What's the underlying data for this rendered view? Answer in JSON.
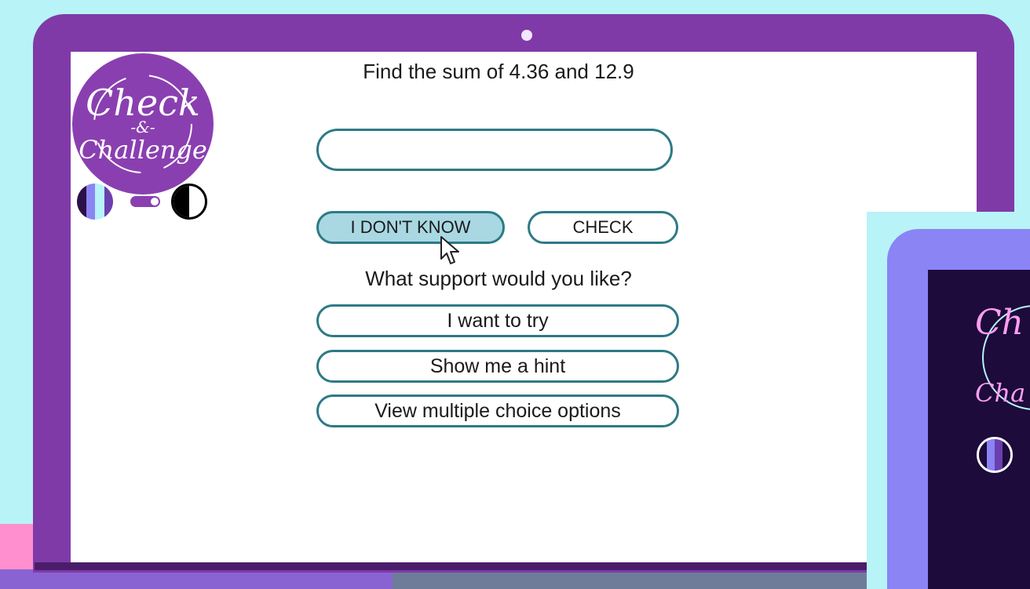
{
  "logo": {
    "line1": "Check",
    "line2": "-&-",
    "line3": "Challenge"
  },
  "question": {
    "text": "Find the sum of 4.36 and 12.9",
    "answer_value": "",
    "answer_placeholder": ""
  },
  "actions": {
    "dont_know_label": "I DON'T KNOW",
    "check_label": "CHECK"
  },
  "support": {
    "heading": "What support would you like?",
    "options": [
      "I want to try",
      "Show me a hint",
      "View multiple choice options"
    ]
  },
  "preview": {
    "logo_line1": "Ch",
    "logo_line3": "Cha"
  },
  "colors": {
    "frame": "#7f3aa8",
    "accent": "#2d7a86",
    "button_active": "#a9d8e3",
    "background": "#b8f3f8",
    "preview_screen": "#1c0b3b"
  },
  "icons": {
    "color_theme": "striped-circle-icon",
    "toggle": "toggle-switch-icon",
    "contrast": "contrast-icon",
    "pointer": "cursor-pointer-icon"
  }
}
